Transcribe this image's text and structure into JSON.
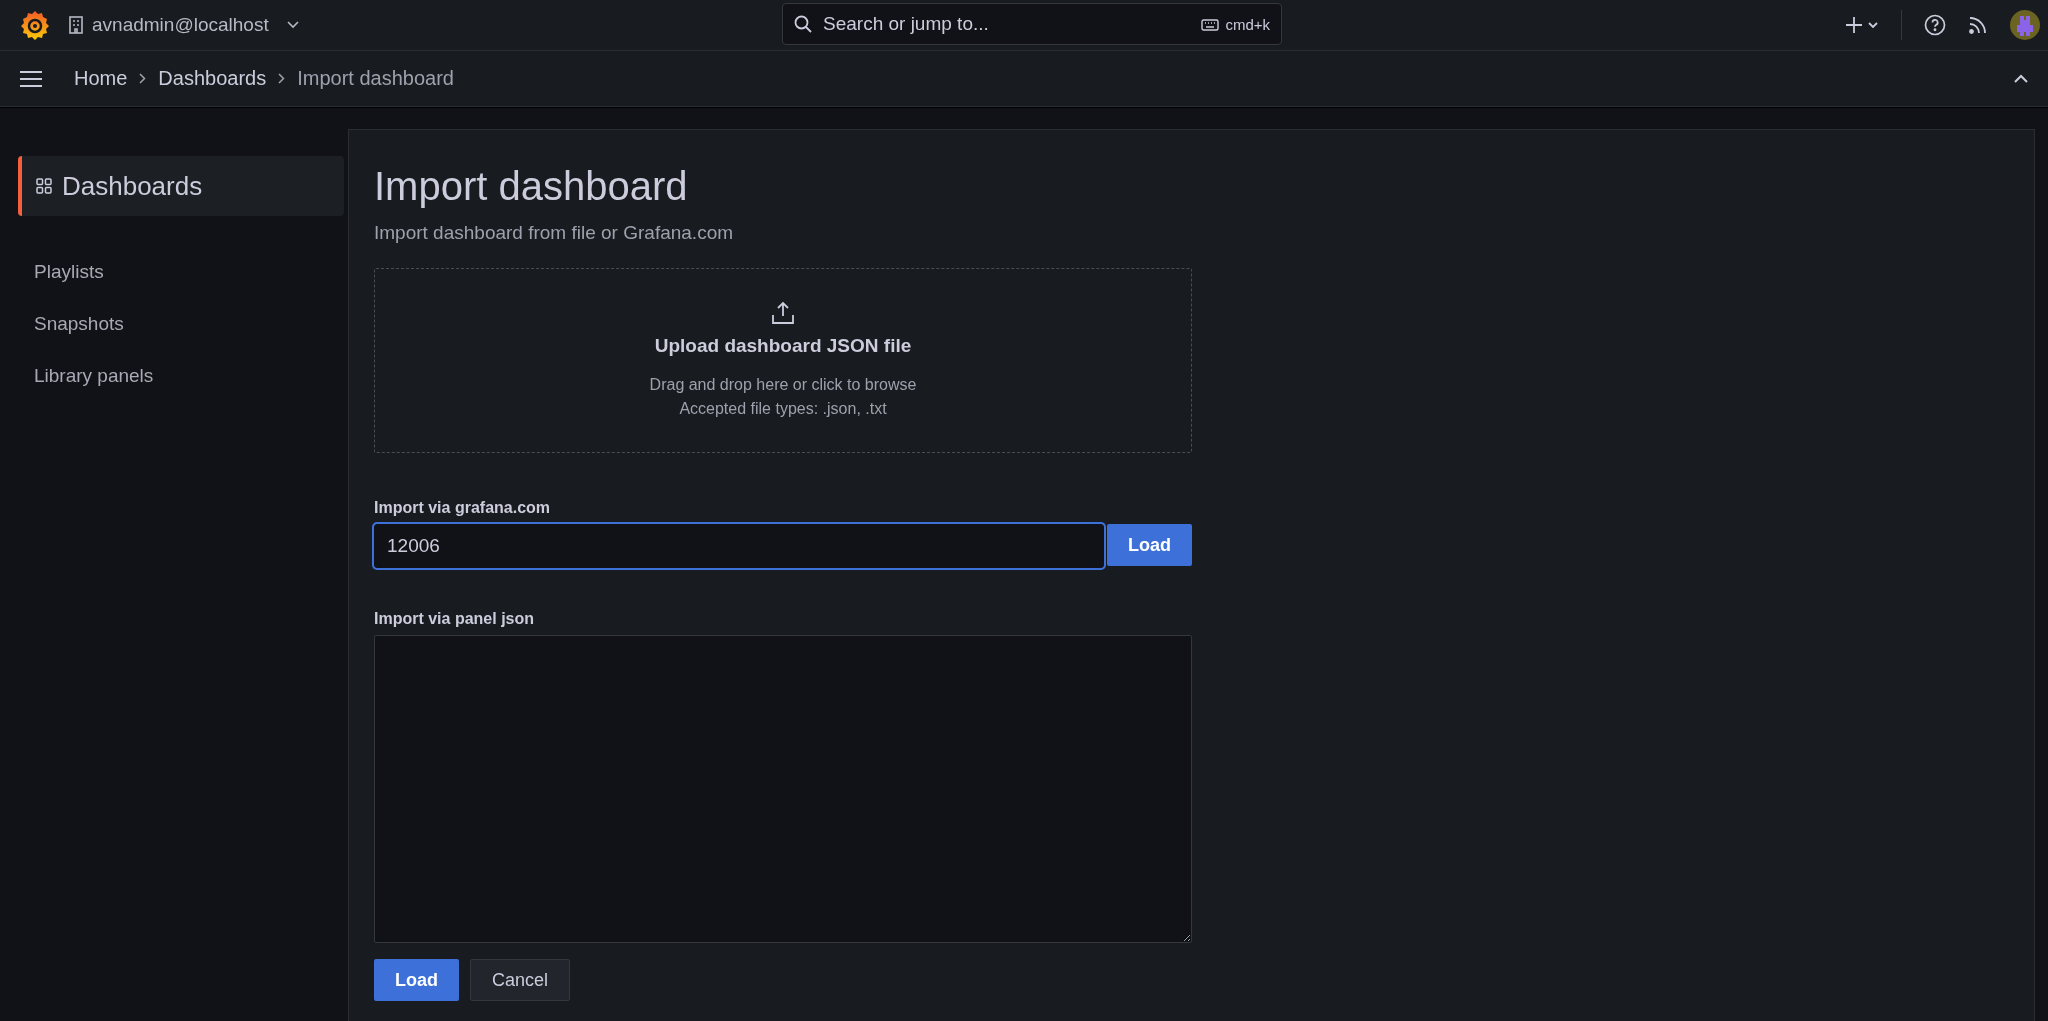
{
  "top_bar": {
    "org_switcher": {
      "label": "avnadmin@localhost"
    },
    "search": {
      "placeholder": "Search or jump to...",
      "shortcut": "cmd+k"
    }
  },
  "breadcrumbs": [
    {
      "label": "Home",
      "current": false
    },
    {
      "label": "Dashboards",
      "current": false
    },
    {
      "label": "Import dashboard",
      "current": true
    }
  ],
  "sidebar": {
    "items": [
      {
        "label": "Dashboards",
        "selected": true
      },
      {
        "label": "Playlists",
        "selected": false
      },
      {
        "label": "Snapshots",
        "selected": false
      },
      {
        "label": "Library panels",
        "selected": false
      }
    ]
  },
  "page": {
    "title": "Import dashboard",
    "subtitle": "Import dashboard from file or Grafana.com",
    "upload": {
      "title": "Upload dashboard JSON file",
      "hint": "Drag and drop here or click to browse",
      "accepted": "Accepted file types: .json, .txt"
    },
    "grafana_com": {
      "label": "Import via grafana.com",
      "value": "12006",
      "focused": true,
      "button": "Load"
    },
    "panel_json": {
      "label": "Import via panel json"
    },
    "buttons": [
      {
        "label": "Load",
        "kind": "primary"
      },
      {
        "label": "Cancel",
        "kind": "secondary"
      }
    ]
  }
}
